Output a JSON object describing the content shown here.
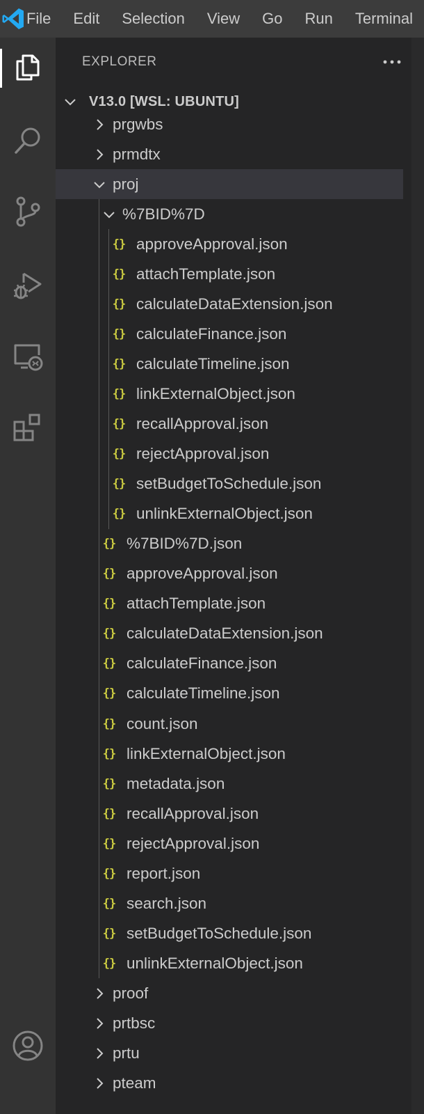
{
  "menu": [
    "File",
    "Edit",
    "Selection",
    "View",
    "Go",
    "Run",
    "Terminal"
  ],
  "colors": {
    "accent": "#007acc",
    "json_icon": "#cbcb41",
    "selected_row": "#37373d"
  },
  "activity": [
    {
      "name": "explorer-icon",
      "active": true
    },
    {
      "name": "search-icon"
    },
    {
      "name": "source-control-icon"
    },
    {
      "name": "run-debug-icon"
    },
    {
      "name": "remote-explorer-icon"
    },
    {
      "name": "extensions-icon"
    },
    {
      "name": "accounts-icon"
    }
  ],
  "sidebar": {
    "title": "EXPLORER",
    "section_title": "V13.0 [WSL: UBUNTU]",
    "tree": [
      {
        "type": "folder",
        "expanded": false,
        "depth": 1,
        "label": "prgwbs"
      },
      {
        "type": "folder",
        "expanded": false,
        "depth": 1,
        "label": "prmdtx"
      },
      {
        "type": "folder",
        "expanded": true,
        "depth": 1,
        "label": "proj",
        "selected": true
      },
      {
        "type": "folder",
        "expanded": true,
        "depth": 2,
        "label": "%7BID%7D"
      },
      {
        "type": "file",
        "depth": 3,
        "label": "approveApproval.json"
      },
      {
        "type": "file",
        "depth": 3,
        "label": "attachTemplate.json"
      },
      {
        "type": "file",
        "depth": 3,
        "label": "calculateDataExtension.json"
      },
      {
        "type": "file",
        "depth": 3,
        "label": "calculateFinance.json"
      },
      {
        "type": "file",
        "depth": 3,
        "label": "calculateTimeline.json"
      },
      {
        "type": "file",
        "depth": 3,
        "label": "linkExternalObject.json"
      },
      {
        "type": "file",
        "depth": 3,
        "label": "recallApproval.json"
      },
      {
        "type": "file",
        "depth": 3,
        "label": "rejectApproval.json"
      },
      {
        "type": "file",
        "depth": 3,
        "label": "setBudgetToSchedule.json"
      },
      {
        "type": "file",
        "depth": 3,
        "label": "unlinkExternalObject.json"
      },
      {
        "type": "file",
        "depth": 2,
        "label": "%7BID%7D.json"
      },
      {
        "type": "file",
        "depth": 2,
        "label": "approveApproval.json"
      },
      {
        "type": "file",
        "depth": 2,
        "label": "attachTemplate.json"
      },
      {
        "type": "file",
        "depth": 2,
        "label": "calculateDataExtension.json"
      },
      {
        "type": "file",
        "depth": 2,
        "label": "calculateFinance.json"
      },
      {
        "type": "file",
        "depth": 2,
        "label": "calculateTimeline.json"
      },
      {
        "type": "file",
        "depth": 2,
        "label": "count.json"
      },
      {
        "type": "file",
        "depth": 2,
        "label": "linkExternalObject.json"
      },
      {
        "type": "file",
        "depth": 2,
        "label": "metadata.json"
      },
      {
        "type": "file",
        "depth": 2,
        "label": "recallApproval.json"
      },
      {
        "type": "file",
        "depth": 2,
        "label": "rejectApproval.json"
      },
      {
        "type": "file",
        "depth": 2,
        "label": "report.json"
      },
      {
        "type": "file",
        "depth": 2,
        "label": "search.json"
      },
      {
        "type": "file",
        "depth": 2,
        "label": "setBudgetToSchedule.json"
      },
      {
        "type": "file",
        "depth": 2,
        "label": "unlinkExternalObject.json"
      },
      {
        "type": "folder",
        "expanded": false,
        "depth": 1,
        "label": "proof"
      },
      {
        "type": "folder",
        "expanded": false,
        "depth": 1,
        "label": "prtbsc"
      },
      {
        "type": "folder",
        "expanded": false,
        "depth": 1,
        "label": "prtu"
      },
      {
        "type": "folder",
        "expanded": false,
        "depth": 1,
        "label": "pteam"
      }
    ]
  }
}
